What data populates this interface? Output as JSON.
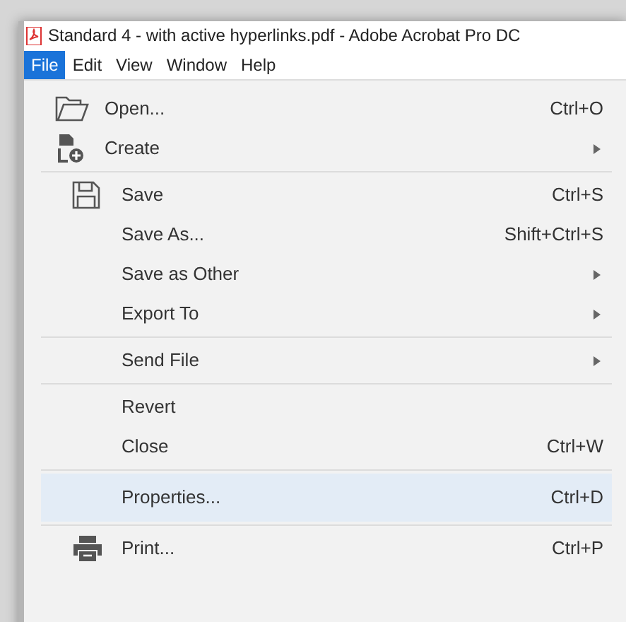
{
  "window": {
    "title": "Standard 4 - with active hyperlinks.pdf - Adobe Acrobat Pro DC"
  },
  "menubar": [
    {
      "label": "File",
      "selected": true
    },
    {
      "label": "Edit",
      "selected": false
    },
    {
      "label": "View",
      "selected": false
    },
    {
      "label": "Window",
      "selected": false
    },
    {
      "label": "Help",
      "selected": false
    }
  ],
  "menu_groups": [
    [
      {
        "kind": "folder",
        "label": "Open...",
        "shortcut": "Ctrl+O",
        "submenu": false,
        "selected": false
      },
      {
        "kind": "create",
        "label": "Create",
        "submenu": true,
        "selected": false
      }
    ],
    [
      {
        "kind": "save",
        "label": "Save",
        "shortcut": "Ctrl+S",
        "submenu": false,
        "selected": false
      },
      {
        "kind": "plain",
        "label": "Save As...",
        "shortcut": "Shift+Ctrl+S",
        "submenu": false,
        "selected": false
      },
      {
        "kind": "plain",
        "label": "Save as Other",
        "submenu": true,
        "selected": false
      },
      {
        "kind": "plain",
        "label": "Export To",
        "submenu": true,
        "selected": false
      }
    ],
    [
      {
        "kind": "plain",
        "label": "Send File",
        "submenu": true,
        "selected": false
      }
    ],
    [
      {
        "kind": "plain",
        "label": "Revert",
        "submenu": false,
        "selected": false
      },
      {
        "kind": "plain",
        "label": "Close",
        "shortcut": "Ctrl+W",
        "submenu": false,
        "selected": false
      }
    ],
    [
      {
        "kind": "plain",
        "label": "Properties...",
        "shortcut": "Ctrl+D",
        "submenu": false,
        "selected": true
      }
    ],
    [
      {
        "kind": "print",
        "label": "Print...",
        "shortcut": "Ctrl+P",
        "submenu": false,
        "selected": false
      }
    ]
  ]
}
